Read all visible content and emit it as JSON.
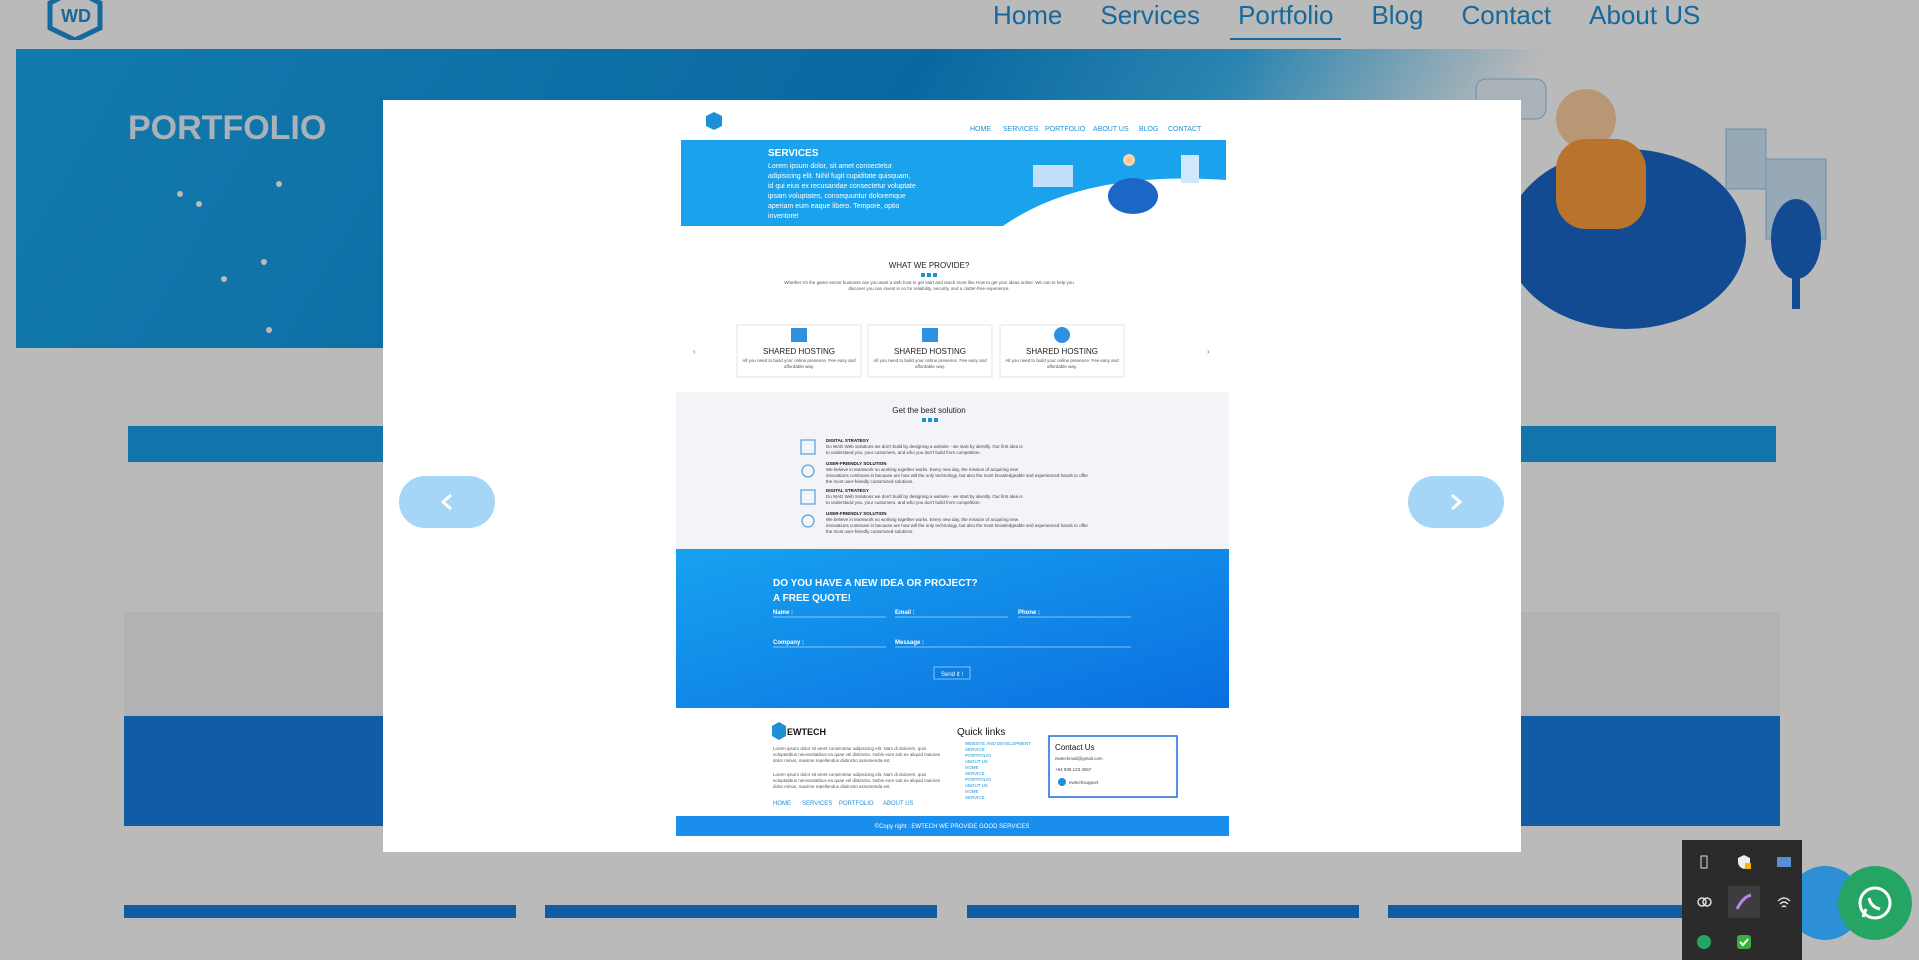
{
  "nav": {
    "items": [
      {
        "label": "Home"
      },
      {
        "label": "Services"
      },
      {
        "label": "Portfolio"
      },
      {
        "label": "Blog"
      },
      {
        "label": "Contact"
      },
      {
        "label": "About US"
      }
    ],
    "active_index": 2
  },
  "hero": {
    "title": "PORTFOLIO"
  },
  "preview": {
    "nav": [
      "HOME",
      "SERVICES",
      "PORTFOLIO",
      "ABOUT US",
      "BLOG",
      "CONTACT"
    ],
    "banner_title": "SERVICES",
    "banner_text": [
      "Lorem ipsum dolor, sit amet consectetur",
      "adipisicing elit. Nihil fugit cupiditate quisquam,",
      "id qui eius ex recusandae consectetur voluptate",
      "ipsam voluptates, consequuntur doloremque",
      "aperiam eum eaque libero. Tempore, optio",
      "inventore!"
    ],
    "provide_title": "WHAT WE PROVIDE?",
    "provide_text": [
      "Whether it's the game-sector business can you want a web host to get start and reach more like How to get your ideas online. We can to help you",
      "discover you can invest in so for reliability, security, and a clutter-free experience."
    ],
    "cards": [
      {
        "title": "SHARED HOSTING",
        "text": [
          "All you need to build your online presence. Fee easy and",
          "affordable way."
        ],
        "icon": "server-icon"
      },
      {
        "title": "SHARED HOSTING",
        "text": [
          "All you need to build your online presence. Fee easy and",
          "affordable way."
        ],
        "icon": "server-icon"
      },
      {
        "title": "SHARED HOSTING",
        "text": [
          "All you need to build your online presence. Fee easy and",
          "affordable way."
        ],
        "icon": "wordpress-icon"
      }
    ],
    "solution_title": "Get the best solution",
    "solutions": [
      {
        "head": "DIGITAL STRATEGY",
        "text": [
          "Do WAD Web Solutions we don't build by designing a website - we start by identify. Our first idea is",
          "to understand you, your customers, and who you don't build from competition."
        ],
        "icon": "chart-icon"
      },
      {
        "head": "USER-FRIENDLY SOLUTION",
        "text": [
          "We believe in teamwork so working together works. Every new day, the mission of acquiring new",
          "innovations continues in because are how will the only technology, but also the most knowledgeable and experienced hands to offer",
          "the most user-friendly customized solutions."
        ],
        "icon": "bulb-icon"
      },
      {
        "head": "DIGITAL STRATEGY",
        "text": [
          "Do WAD Web Solutions we don't build by designing a website - we start by identify. Our first idea is",
          "to understand you, your customers, and who you don't build from competition."
        ],
        "icon": "chart-icon"
      },
      {
        "head": "USER-FRIENDLY SOLUTION",
        "text": [
          "We believe in teamwork so working together works. Every new day, the mission of acquiring new",
          "innovations continues in because are how will the only technology, but also the most knowledgeable and experienced hands to offer",
          "the most user-friendly customized solutions."
        ],
        "icon": "bulb-icon"
      }
    ],
    "quote_title": [
      "DO YOU HAVE A NEW IDEA OR PROJECT?",
      "A FREE QUOTE!"
    ],
    "form": {
      "name": "Name :",
      "email": "Email :",
      "phone": "Phone :",
      "company": "Company :",
      "message": "Message :",
      "send": "Send it !"
    },
    "footer": {
      "brand": "EWTECH",
      "about": [
        "Lorem ipsum dolor sit amet consectetur adipisicing elit. Nam di dolorem, quis",
        "voluptatibus necessitatibus ea quae vel distinctio. Nobis eum sub ex aliquid maiores",
        "dolor minus, maxime repellendus distinctio assumenda est."
      ],
      "about2": [
        "Lorem ipsum dolor sit amet consectetur adipisicing elit. Nam di dolorem, quis",
        "voluptatibus necessitatibus ea quae vel distinctio. Nobis eum sub ex aliquid maiores",
        "dolor minus, maxime repellendus distinctio assumenda est."
      ],
      "links": [
        "HOME",
        "SERVICES",
        "PORTFOLIO",
        "ABOUT US"
      ],
      "quick_title": "Quick links",
      "quick": [
        "WEBSITE AND DEVELOPMENT",
        "SERVICE",
        "PORTFOLIO",
        "ABOUT US",
        "HOME",
        "SERVICE",
        "PORTFOLIO",
        "ABOUT US",
        "HOME",
        "SERVICE"
      ],
      "contact_title": "Contact Us",
      "contact": [
        "ewtechmail@gmail.com",
        "+84 938 123 4567",
        "ewtechsupport"
      ],
      "copyright": "©Copy right : EWTECH WE PROVIDE GOOD SERVICES"
    }
  },
  "colors": {
    "accent": "#1e90d6",
    "hero": "#0f8fdc",
    "arrow": "#a5d6f5",
    "whatsapp": "#25a564"
  },
  "icons": {
    "prev": "chevron-left-icon",
    "next": "chevron-right-icon",
    "whatsapp": "whatsapp-icon"
  }
}
